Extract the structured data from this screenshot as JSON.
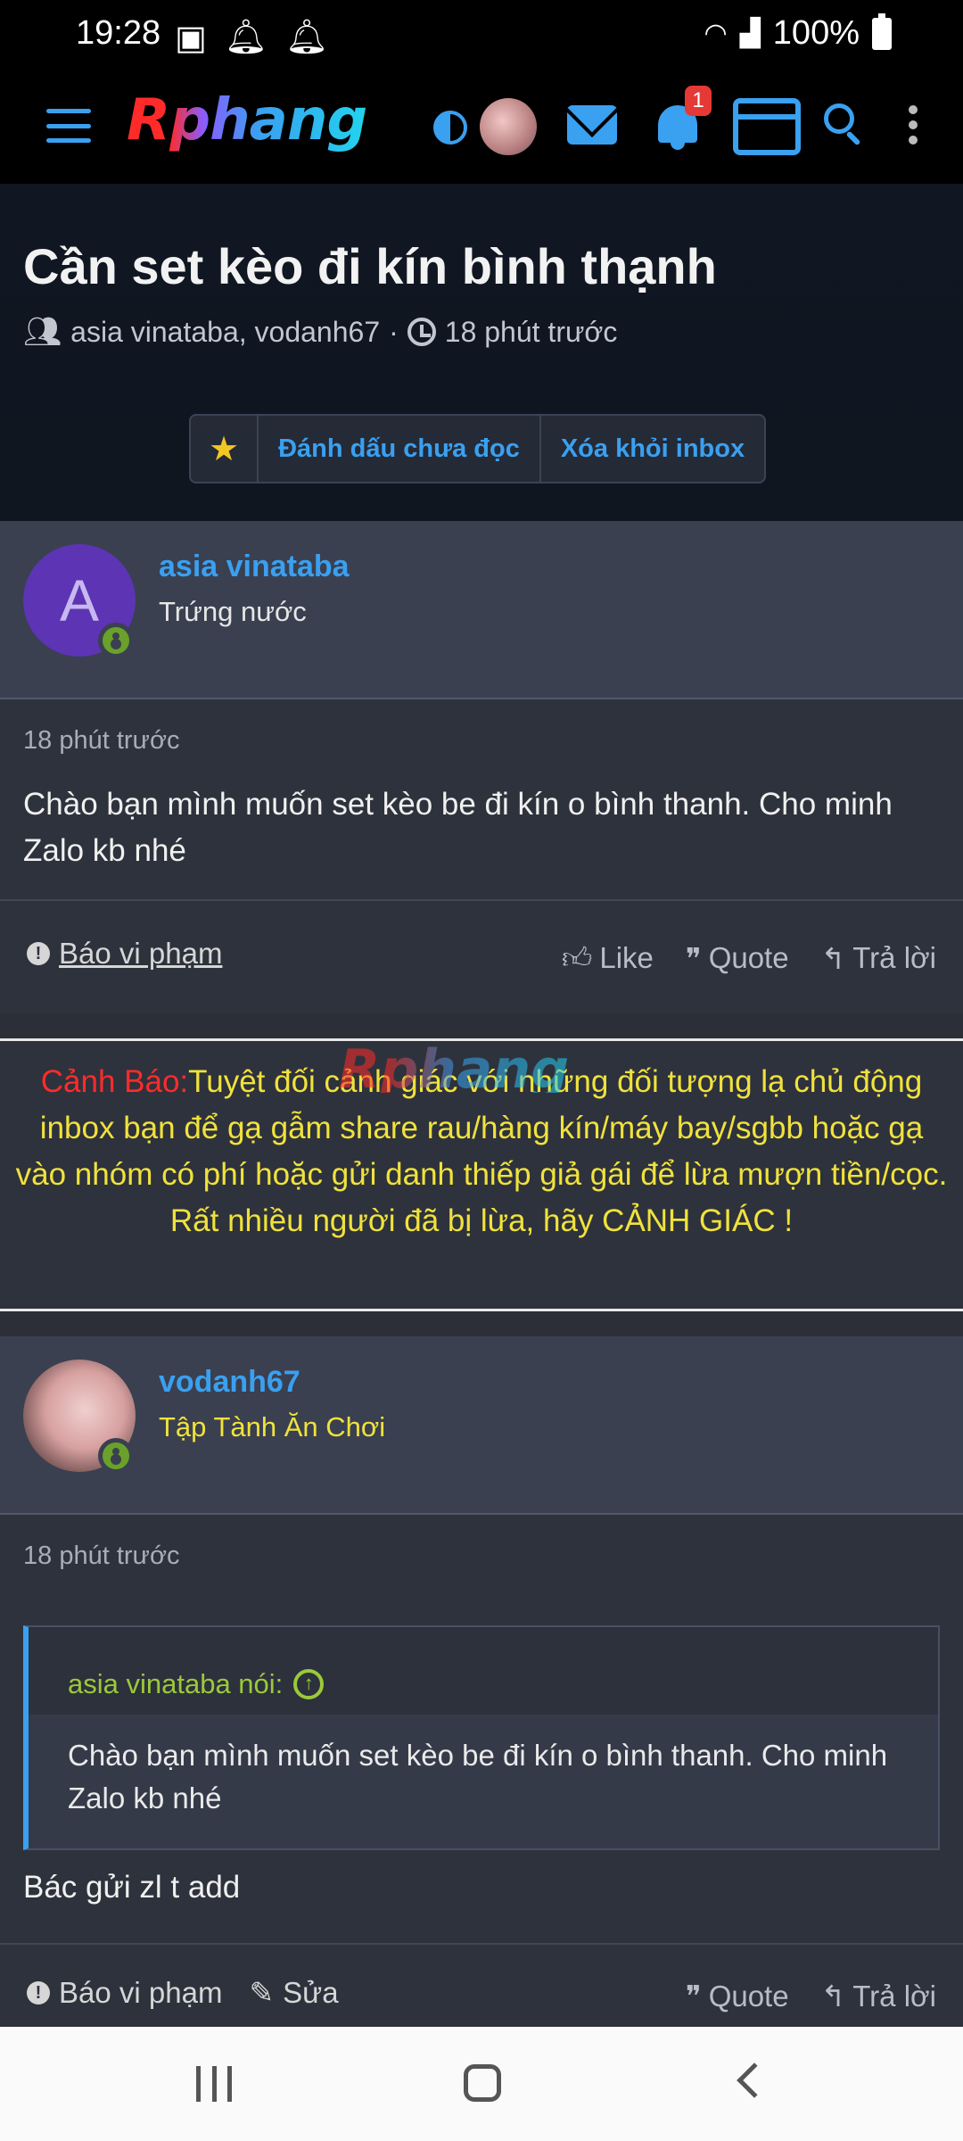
{
  "status_bar": {
    "time": "19:28",
    "battery": "100%"
  },
  "nav": {
    "logo": "Rphang",
    "notification_count": "1"
  },
  "thread": {
    "title": "Cần set kèo đi kín bình thạnh",
    "participants": "asia vinataba, vodanh67",
    "separator": "·",
    "time": "18 phút trước",
    "mark_unread": "Đánh dấu chưa đọc",
    "remove_inbox": "Xóa khỏi inbox"
  },
  "messages": [
    {
      "username": "asia vinataba",
      "avatar_letter": "A",
      "user_title": "Trứng nước",
      "time": "18 phút trước",
      "text": "Chào bạn mình muốn set kèo be đi kín o bình thanh. Cho minh Zalo kb nhé",
      "report": "Báo vi phạm",
      "like": "Like",
      "quote": "Quote",
      "reply": "Trả lời"
    },
    {
      "username": "vodanh67",
      "user_title": "Tập Tành Ăn Chơi",
      "time": "18 phút trước",
      "quote_author": "asia vinataba nói:",
      "quote_text": "Chào bạn mình muốn set kèo be đi kín o bình thanh. Cho minh Zalo kb nhé",
      "text": "Bác gửi zl t add",
      "report": "Báo vi phạm",
      "edit": "Sửa",
      "quote": "Quote",
      "reply": "Trả lời"
    }
  ],
  "warning": {
    "label": "Cảnh Báo:",
    "text": "Tuyệt đối cảnh giác với những đối tượng lạ chủ động inbox bạn để gạ gẫm share rau/hàng kín/máy bay/sgbb hoặc gạ vào nhóm có phí hoặc gửi danh thiếp giả gái để lừa mượn tiền/cọc.",
    "text2": "Rất nhiều người đã bị lừa, hãy CẢNH GIÁC !"
  },
  "colors": {
    "accent": "#3aa0f0",
    "warning_text": "#f0e23c",
    "warning_label": "#ff2b2b",
    "online": "#6aa12a"
  }
}
